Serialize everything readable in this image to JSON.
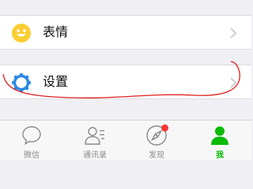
{
  "menu": {
    "emoji_label": "表情",
    "settings_label": "设置"
  },
  "tabbar": {
    "tabs": [
      {
        "label": "微信",
        "icon": "chat-bubble-icon",
        "active": false
      },
      {
        "label": "通讯录",
        "icon": "contacts-icon",
        "active": false
      },
      {
        "label": "发现",
        "icon": "compass-icon",
        "active": false,
        "badge": "red-dot"
      },
      {
        "label": "我",
        "icon": "person-icon",
        "active": true
      }
    ]
  },
  "colors": {
    "accent": "#09bb07",
    "emoji_yellow": "#fbce33",
    "settings_blue": "#2c8ae6",
    "badge_red": "#f43530",
    "annotation_red": "#e0201f"
  }
}
